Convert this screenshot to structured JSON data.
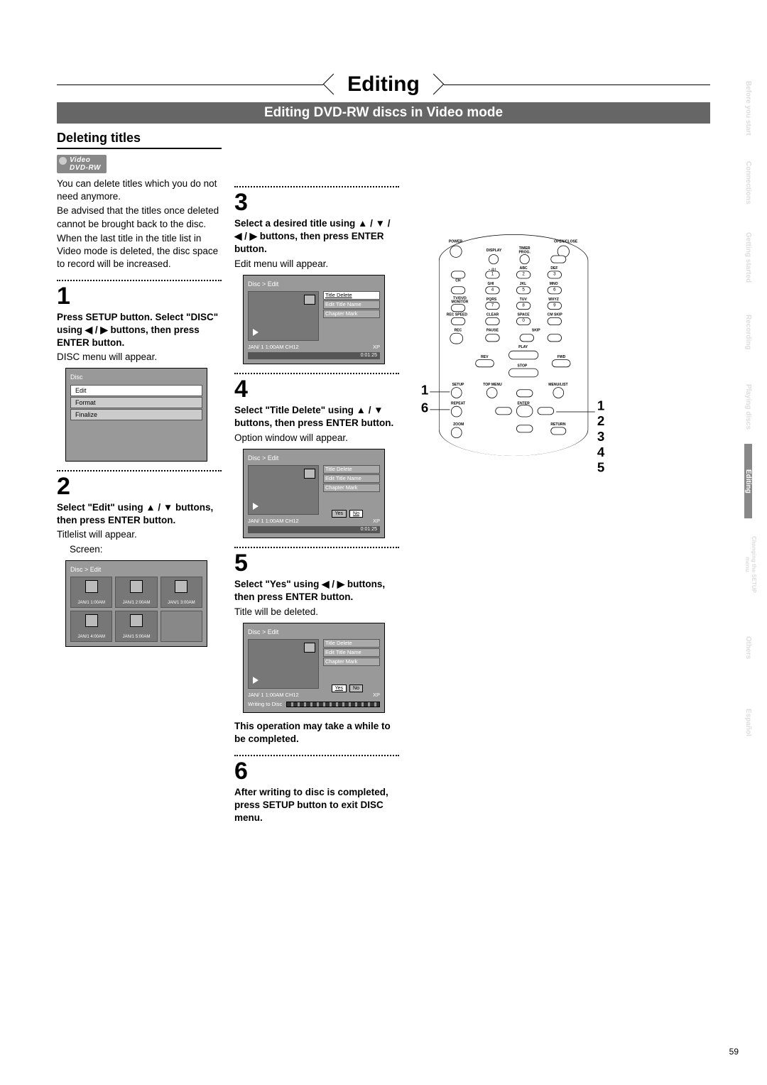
{
  "header": {
    "title": "Editing",
    "subtitle": "Editing DVD-RW discs in Video mode",
    "section": "Deleting titles",
    "badge_top": "Video",
    "badge_bot": "DVD-RW"
  },
  "intro": {
    "p1": "You can delete titles which you do not need anymore.",
    "p2": "Be advised that the titles once deleted cannot be brought back to the disc.",
    "p3": "When the last title in the title list in Video mode is deleted, the disc space to record will be increased."
  },
  "steps": {
    "s1": {
      "num": "1",
      "bold": "Press SETUP button. Select \"DISC\" using ◀ / ▶ buttons, then press ENTER button.",
      "plain": "DISC menu will appear."
    },
    "s2": {
      "num": "2",
      "bold": "Select \"Edit\" using ▲ / ▼ buttons, then press ENTER button.",
      "plain": "Titlelist will appear.",
      "indent": "Screen:"
    },
    "s3": {
      "num": "3",
      "bold": "Select a desired title using ▲ / ▼ / ◀ / ▶ buttons, then press ENTER button.",
      "plain": "Edit menu will appear."
    },
    "s4": {
      "num": "4",
      "bold": "Select \"Title Delete\" using ▲ / ▼ buttons, then press ENTER button.",
      "plain": "Option window will appear."
    },
    "s5": {
      "num": "5",
      "bold": "Select \"Yes\" using ◀ / ▶ buttons, then press ENTER button.",
      "plain": "Title will be deleted.",
      "note": "This operation may take a while to be completed."
    },
    "s6": {
      "num": "6",
      "bold": "After writing to disc is completed, press SETUP button to exit DISC menu."
    }
  },
  "screens": {
    "disc": {
      "title": "Disc",
      "items": [
        "Edit",
        "Format",
        "Finalize"
      ]
    },
    "titlelist": {
      "head": "Disc > Edit",
      "cells": [
        "JAN/1  1:00AM",
        "JAN/1  2:00AM",
        "JAN/1  3:00AM",
        "JAN/1  4:00AM",
        "JAN/1  5:00AM"
      ]
    },
    "edit3": {
      "head": "Disc > Edit",
      "menu": [
        "Title Delete",
        "Edit Title Name",
        "Chapter Mark"
      ],
      "foot_l": "JAN/ 1   1:00AM  CH12",
      "foot_r": "XP",
      "bar": "0:01:25"
    },
    "edit4": {
      "head": "Disc > Edit",
      "menu": [
        "Title Delete",
        "Edit Title Name",
        "Chapter Mark"
      ],
      "yes": "Yes",
      "no": "No",
      "foot_l": "JAN/ 1   1:00AM  CH12",
      "foot_r": "XP",
      "bar": "0:01:25"
    },
    "edit5": {
      "head": "Disc > Edit",
      "menu": [
        "Title Delete",
        "Edit Title Name",
        "Chapter Mark"
      ],
      "yes": "Yes",
      "no": "No",
      "foot_l": "JAN/ 1   1:00AM  CH12",
      "foot_r": "XP",
      "writing": "Writing to Disc"
    }
  },
  "remote": {
    "labels": {
      "power": "POWER",
      "openclose": "OPEN/CLOSE",
      "display": "DISPLAY",
      "timer": "TIMER PROG.",
      "atsym": "・@!",
      "abc": "ABC",
      "def": "DEF",
      "ch": "CH",
      "ghi": "GHI",
      "jkl": "JKL",
      "mno": "MNO",
      "tvdvd": "TV/DVD MONITOR",
      "pqrs": "PQRS",
      "tuv": "TUV",
      "wxyz": "WXYZ",
      "recspeed": "REC SPEED",
      "clear": "CLEAR",
      "space": "SPACE",
      "cmskip": "CM SKIP",
      "rec": "REC",
      "pause": "PAUSE",
      "skip": "SKIP",
      "play": "PLAY",
      "rev": "REV",
      "fwd": "FWD",
      "stop": "STOP",
      "setup": "SETUP",
      "topmenu": "TOP MENU",
      "menulist": "MENU/LIST",
      "repeat": "REPEAT",
      "enter": "ENTER",
      "zoom": "ZOOM",
      "return": "RETURN",
      "n1": "1",
      "n2": "2",
      "n3": "3",
      "n4": "4",
      "n5": "5",
      "n6": "6",
      "n7": "7",
      "n8": "8",
      "n9": "9",
      "n0": "0"
    },
    "callouts_left": {
      "a": "1",
      "b": "6"
    },
    "callouts_right": {
      "a": "1",
      "b": "2",
      "c": "3",
      "d": "4",
      "e": "5"
    }
  },
  "tabs": [
    {
      "label": "Before you start",
      "active": false
    },
    {
      "label": "Connections",
      "active": false
    },
    {
      "label": "Getting started",
      "active": false
    },
    {
      "label": "Recording",
      "active": false
    },
    {
      "label": "Playing discs",
      "active": false
    },
    {
      "label": "Editing",
      "active": true
    },
    {
      "label": "Changing the SETUP menu",
      "active": false
    },
    {
      "label": "Others",
      "active": false
    },
    {
      "label": "Español",
      "active": false
    }
  ],
  "page_number": "59"
}
